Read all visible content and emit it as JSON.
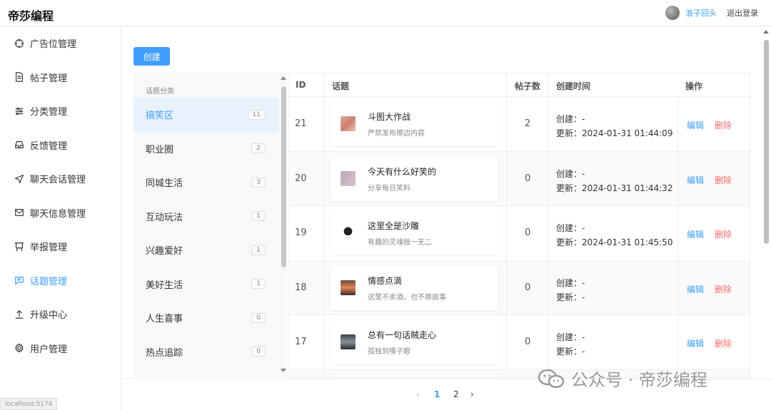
{
  "app": {
    "title": "帝莎编程"
  },
  "user": {
    "name": "浪子回头",
    "logout_label": "退出登录"
  },
  "sidebar": {
    "items": [
      {
        "label": "广告位管理",
        "icon": "target-icon"
      },
      {
        "label": "帖子管理",
        "icon": "document-icon"
      },
      {
        "label": "分类管理",
        "icon": "sliders-icon"
      },
      {
        "label": "反馈管理",
        "icon": "inbox-icon"
      },
      {
        "label": "聊天会话管理",
        "icon": "send-icon"
      },
      {
        "label": "聊天信息管理",
        "icon": "mail-icon"
      },
      {
        "label": "举报管理",
        "icon": "presentation-icon"
      },
      {
        "label": "话题管理",
        "icon": "chat-icon"
      },
      {
        "label": "升级中心",
        "icon": "upload-icon"
      },
      {
        "label": "用户管理",
        "icon": "gear-icon"
      }
    ]
  },
  "toolbar": {
    "create_label": "创建"
  },
  "categories": {
    "title": "话题分类",
    "items": [
      {
        "label": "搞笑区",
        "count": "11"
      },
      {
        "label": "职业圈",
        "count": "2"
      },
      {
        "label": "同城生活",
        "count": "3"
      },
      {
        "label": "互动玩法",
        "count": "1"
      },
      {
        "label": "兴趣爱好",
        "count": "1"
      },
      {
        "label": "美好生活",
        "count": "1"
      },
      {
        "label": "人生喜事",
        "count": "0"
      },
      {
        "label": "热点追踪",
        "count": "0"
      }
    ]
  },
  "table": {
    "headers": {
      "id": "ID",
      "topic": "话题",
      "count": "帖子数",
      "time": "创建时间",
      "ops": "操作"
    },
    "rows": [
      {
        "id": "21",
        "name": "斗图大作战",
        "desc": "严禁发布擦边内容",
        "count": "2",
        "created": "创建：-",
        "updated": "更新：2024-01-31 01:44:09",
        "edit": "编辑",
        "delete": "删除"
      },
      {
        "id": "20",
        "name": "今天有什么好笑的",
        "desc": "分享每日笑料",
        "count": "0",
        "created": "创建：-",
        "updated": "更新：2024-01-31 01:44:32",
        "edit": "编辑",
        "delete": "删除"
      },
      {
        "id": "19",
        "name": "这里全是沙雕",
        "desc": "有趣的灵魂独一无二",
        "count": "0",
        "created": "创建：-",
        "updated": "更新：2024-01-31 01:45:50",
        "edit": "编辑",
        "delete": "删除"
      },
      {
        "id": "18",
        "name": "情感点滴",
        "desc": "这里不卖酒，也不换故事",
        "count": "0",
        "created": "创建：-",
        "updated": "更新：-",
        "edit": "编辑",
        "delete": "删除"
      },
      {
        "id": "17",
        "name": "总有一句话贼走心",
        "desc": "孤独到嗓子眼",
        "count": "0",
        "created": "创建：-",
        "updated": "更新：-",
        "edit": "编辑",
        "delete": "删除"
      }
    ]
  },
  "pagination": {
    "pages": [
      "1",
      "2"
    ],
    "current": "1"
  },
  "watermark": {
    "text": "公众号 · 帝莎编程"
  },
  "status": {
    "url": "localhost:5174"
  },
  "colors": {
    "accent": "#409eff",
    "danger": "#f56c6c"
  }
}
